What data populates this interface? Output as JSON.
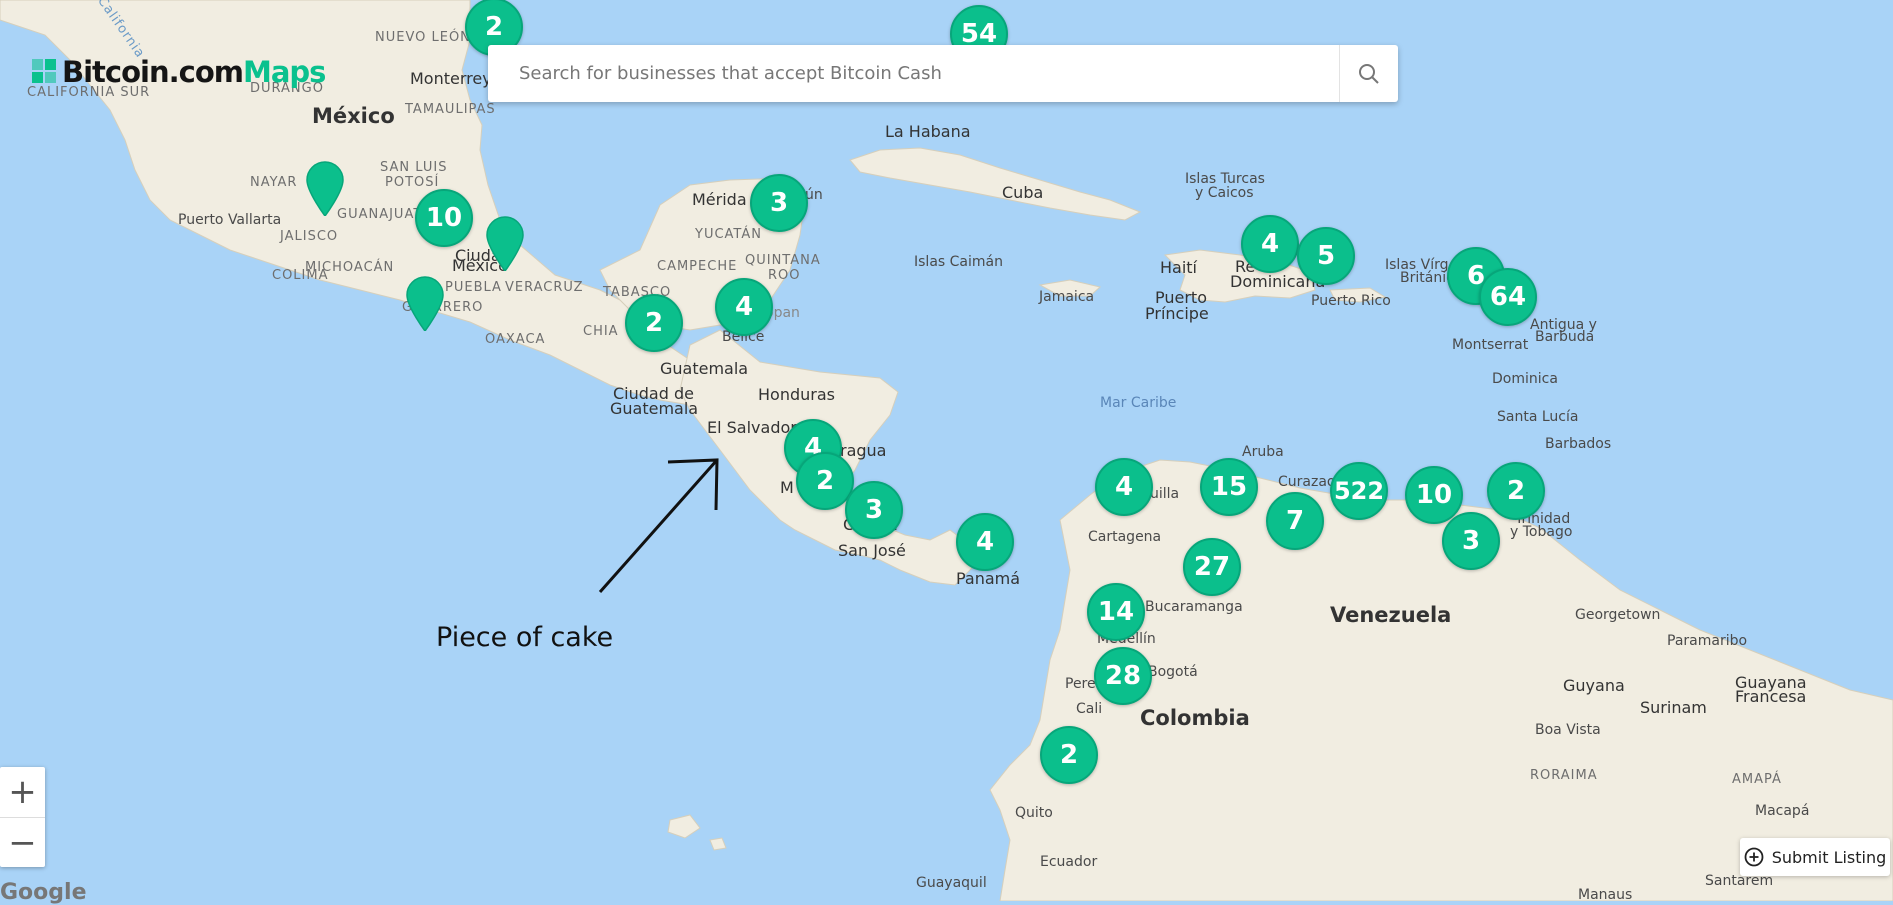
{
  "brand": {
    "name_part1": "Bitcoin.com",
    "name_part2": "Maps",
    "accent": "#0ac18e"
  },
  "search": {
    "placeholder": "Search for businesses that accept Bitcoin Cash",
    "icon": "search-icon"
  },
  "places": [
    {
      "id": "california",
      "label": "California"
    },
    {
      "id": "nuevo-leon",
      "label": "NUEVO LEÓN"
    },
    {
      "id": "monterrey",
      "label": "Monterrey"
    },
    {
      "id": "california-sur",
      "label": "CALIFORNIA SUR"
    },
    {
      "id": "durango",
      "label": "DURANGO"
    },
    {
      "id": "tamaulipas",
      "label": "TAMAULIPAS"
    },
    {
      "id": "mexico",
      "label": "México"
    },
    {
      "id": "san-luis-potosi-1",
      "label": "SAN LUIS"
    },
    {
      "id": "san-luis-potosi-2",
      "label": "POTOSÍ"
    },
    {
      "id": "nayarit",
      "label": "NAYAR"
    },
    {
      "id": "guanajuato",
      "label": "GUANAJUATO"
    },
    {
      "id": "puerto-vallarta",
      "label": "Puerto Vallarta"
    },
    {
      "id": "jalisco",
      "label": "JALISCO"
    },
    {
      "id": "michoacan",
      "label": "MICHOACÁN"
    },
    {
      "id": "ciudad-de-mexico-1",
      "label": "Ciudad"
    },
    {
      "id": "ciudad-de-mexico-2",
      "label": "México"
    },
    {
      "id": "colima",
      "label": "COLIMA"
    },
    {
      "id": "puebla",
      "label": "PUEBLA"
    },
    {
      "id": "veracruz",
      "label": "VERACRUZ"
    },
    {
      "id": "guerrero",
      "label": "GUERRERO"
    },
    {
      "id": "oaxaca",
      "label": "OAXACA"
    },
    {
      "id": "merida",
      "label": "Mérida"
    },
    {
      "id": "cancun",
      "label": "ún"
    },
    {
      "id": "yucatan",
      "label": "YUCATÁN"
    },
    {
      "id": "quintana-roo-1",
      "label": "QUINTANA"
    },
    {
      "id": "quintana-roo-2",
      "label": "ROO"
    },
    {
      "id": "campeche",
      "label": "CAMPECHE"
    },
    {
      "id": "tabasco",
      "label": "TABASCO"
    },
    {
      "id": "chiapas",
      "label": "CHIA"
    },
    {
      "id": "belize-sea",
      "label": "ópan"
    },
    {
      "id": "belice",
      "label": "Belice"
    },
    {
      "id": "guatemala",
      "label": "Guatemala"
    },
    {
      "id": "ciudad-de-guatemala-1",
      "label": "Ciudad de"
    },
    {
      "id": "ciudad-de-guatemala-2",
      "label": "Guatemala"
    },
    {
      "id": "honduras",
      "label": "Honduras"
    },
    {
      "id": "el-salvador",
      "label": "El Salvador"
    },
    {
      "id": "nicaragua",
      "label": "ragua"
    },
    {
      "id": "managua",
      "label": "M"
    },
    {
      "id": "costa-rica",
      "label": "Co"
    },
    {
      "id": "costa-rica-2",
      "label": "a"
    },
    {
      "id": "san-jose",
      "label": "San José"
    },
    {
      "id": "panama",
      "label": "Panamá"
    },
    {
      "id": "la-habana",
      "label": "La Habana"
    },
    {
      "id": "cuba",
      "label": "Cuba"
    },
    {
      "id": "islas-caiman",
      "label": "Islas Caimán"
    },
    {
      "id": "jamaica",
      "label": "Jamaica"
    },
    {
      "id": "haiti",
      "label": "Haití"
    },
    {
      "id": "puerto-principe-1",
      "label": "Puerto"
    },
    {
      "id": "puerto-principe-2",
      "label": "Príncipe"
    },
    {
      "id": "rep-dominicana-1",
      "label": "Re"
    },
    {
      "id": "rep-dominicana-2",
      "label": "Dominicana"
    },
    {
      "id": "puerto-rico",
      "label": "Puerto Rico"
    },
    {
      "id": "turks-1",
      "label": "Islas Turcas"
    },
    {
      "id": "turks-2",
      "label": "y Caicos"
    },
    {
      "id": "bvi-1",
      "label": "Islas Vírg"
    },
    {
      "id": "bvi-2",
      "label": "Británic"
    },
    {
      "id": "antigua-1",
      "label": "Antigua y"
    },
    {
      "id": "antigua-2",
      "label": "Barbuda"
    },
    {
      "id": "montserrat",
      "label": "Montserrat"
    },
    {
      "id": "dominica",
      "label": "Dominica"
    },
    {
      "id": "santa-lucia",
      "label": "Santa Lucía"
    },
    {
      "id": "barbados",
      "label": "Barbados"
    },
    {
      "id": "mar-caribe",
      "label": "Mar Caribe"
    },
    {
      "id": "aruba",
      "label": "Aruba"
    },
    {
      "id": "curazao",
      "label": "Curazao"
    },
    {
      "id": "trinidad-1",
      "label": "Trinidad"
    },
    {
      "id": "trinidad-2",
      "label": "y Tobago"
    },
    {
      "id": "barranquilla",
      "label": "uilla"
    },
    {
      "id": "cartagena",
      "label": "Cartagena"
    },
    {
      "id": "bucaramanga",
      "label": "Bucaramanga"
    },
    {
      "id": "venezuela",
      "label": "Venezuela"
    },
    {
      "id": "medellin",
      "label": "Medellín"
    },
    {
      "id": "pereira",
      "label": "Pere"
    },
    {
      "id": "bogota",
      "label": "Bogotá"
    },
    {
      "id": "cali",
      "label": "Cali"
    },
    {
      "id": "colombia",
      "label": "Colombia"
    },
    {
      "id": "georgetown",
      "label": "Georgetown"
    },
    {
      "id": "paramaribo",
      "label": "Paramaribo"
    },
    {
      "id": "guyana",
      "label": "Guyana"
    },
    {
      "id": "surinam",
      "label": "Surinam"
    },
    {
      "id": "guayana-1",
      "label": "Guayana"
    },
    {
      "id": "guayana-2",
      "label": "Francesa"
    },
    {
      "id": "boa-vista",
      "label": "Boa Vista"
    },
    {
      "id": "roraima",
      "label": "RORAIMA"
    },
    {
      "id": "amapa",
      "label": "AMAPÁ"
    },
    {
      "id": "macapa",
      "label": "Macapá"
    },
    {
      "id": "quito",
      "label": "Quito"
    },
    {
      "id": "ecuador",
      "label": "Ecuador"
    },
    {
      "id": "guayaquil",
      "label": "Guayaquil"
    },
    {
      "id": "santarem",
      "label": "Santarém"
    },
    {
      "id": "manaus",
      "label": "Manaus"
    }
  ],
  "clusters": [
    {
      "id": "nuevo-leon",
      "count": "2"
    },
    {
      "id": "florida",
      "count": "54"
    },
    {
      "id": "ciudad-de-mexico",
      "count": "10"
    },
    {
      "id": "cancun",
      "count": "3"
    },
    {
      "id": "tabasco",
      "count": "2"
    },
    {
      "id": "belize",
      "count": "4"
    },
    {
      "id": "republica-dominicana",
      "count": "4"
    },
    {
      "id": "puerto-rico",
      "count": "5"
    },
    {
      "id": "virgin-islands",
      "count": "6"
    },
    {
      "id": "antigua",
      "count": "64"
    },
    {
      "id": "nicaragua",
      "count": "4"
    },
    {
      "id": "managua",
      "count": "2"
    },
    {
      "id": "costa-rica",
      "count": "3"
    },
    {
      "id": "panama",
      "count": "4"
    },
    {
      "id": "barranquilla",
      "count": "4"
    },
    {
      "id": "maracaibo",
      "count": "15"
    },
    {
      "id": "falcon",
      "count": "7"
    },
    {
      "id": "caracas",
      "count": "522"
    },
    {
      "id": "barcelona",
      "count": "10"
    },
    {
      "id": "trinidad",
      "count": "2"
    },
    {
      "id": "margarita",
      "count": "3"
    },
    {
      "id": "cucuta",
      "count": "27"
    },
    {
      "id": "medellin",
      "count": "14"
    },
    {
      "id": "bogota",
      "count": "28"
    },
    {
      "id": "pasto",
      "count": "2"
    }
  ],
  "pins": [
    {
      "id": "guadalajara"
    },
    {
      "id": "veracruz"
    },
    {
      "id": "acapulco"
    }
  ],
  "controls": {
    "zoom_in": "+",
    "zoom_out": "−",
    "submit_listing": "Submit Listing"
  },
  "attribution": "Google",
  "annotation": "Piece of cake",
  "colors": {
    "water": "#a9d3f7",
    "land": "#f2eee3",
    "marker": "#0bbf8c",
    "topbar": "#16274a"
  }
}
